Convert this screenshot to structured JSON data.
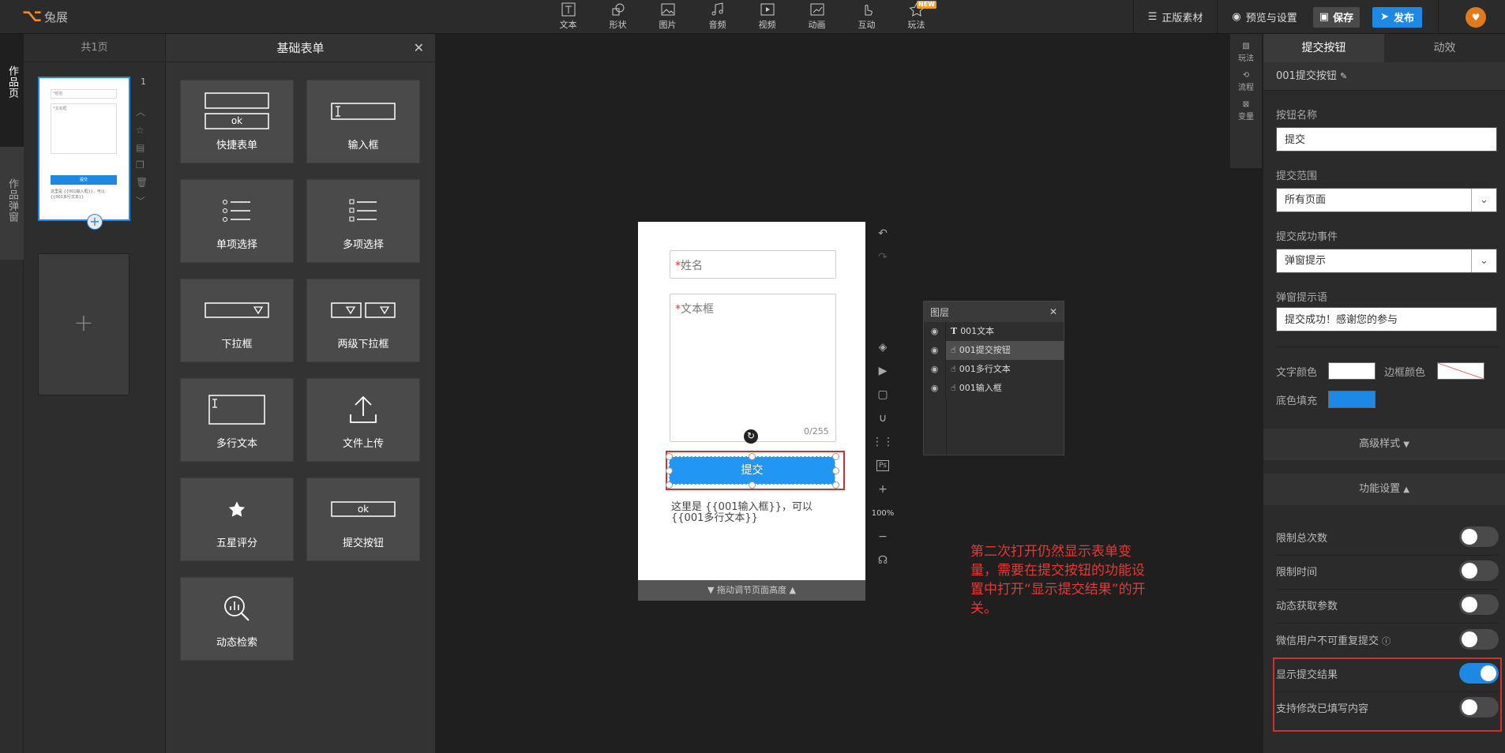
{
  "brand": {
    "name": "兔展"
  },
  "toolbar": {
    "tools": [
      {
        "label": "文本",
        "icon": "text-icon"
      },
      {
        "label": "形状",
        "icon": "shape-icon"
      },
      {
        "label": "图片",
        "icon": "image-icon"
      },
      {
        "label": "音频",
        "icon": "music-icon"
      },
      {
        "label": "视频",
        "icon": "video-icon"
      },
      {
        "label": "动画",
        "icon": "animation-icon"
      },
      {
        "label": "互动",
        "icon": "hand-icon"
      },
      {
        "label": "玩法",
        "icon": "star-icon",
        "badge": "NEW"
      }
    ],
    "material": "正版素材",
    "preview": "预览与设置",
    "save": "保存",
    "publish": "发布"
  },
  "left_tabs": {
    "works_page": "作品页",
    "works_popup": "作品弹窗"
  },
  "pages": {
    "header": "共1页",
    "page_number": "1",
    "thumb": {
      "field1": "*姓名",
      "field2": "*文本框",
      "button": "提交",
      "text": "这里是 {{001输入框}}，可以{{001多行文本}}"
    }
  },
  "components": {
    "title": "基础表单",
    "items": [
      {
        "label": "快捷表单"
      },
      {
        "label": "输入框"
      },
      {
        "label": "单项选择"
      },
      {
        "label": "多项选择"
      },
      {
        "label": "下拉框"
      },
      {
        "label": "两级下拉框"
      },
      {
        "label": "多行文本"
      },
      {
        "label": "文件上传"
      },
      {
        "label": "五星评分"
      },
      {
        "label": "提交按钮"
      },
      {
        "label": "动态检索"
      }
    ],
    "quick_form_ok": "ok",
    "submit_ok": "ok"
  },
  "canvas": {
    "name_placeholder": "姓名",
    "textarea_placeholder": "文本框",
    "required_mark": "*",
    "char_count": "0/255",
    "submit_label": "提交",
    "body_text": "这里是 {{001输入框}}，可以{{001多行文本}}",
    "bottom_bar": "拖动调节页面高度",
    "zoom": "100%"
  },
  "layers": {
    "title": "图层",
    "items": [
      {
        "label": "001文本",
        "selected": false
      },
      {
        "label": "001提交按钮",
        "selected": true
      },
      {
        "label": "001多行文本",
        "selected": false
      },
      {
        "label": "001输入框",
        "selected": false
      }
    ]
  },
  "annotation": "第二次打开仍然显示表单变量，需要在提交按钮的功能设置中打开“显示提交结果”的开关。",
  "quickbar": [
    {
      "label": "玩法"
    },
    {
      "label": "流程"
    },
    {
      "label": "变量"
    }
  ],
  "properties": {
    "tabs": [
      "提交按钮",
      "动效"
    ],
    "element_name": "001提交按钮",
    "button_name_label": "按钮名称",
    "button_name_value": "提交",
    "scope_label": "提交范围",
    "scope_value": "所有页面",
    "success_event_label": "提交成功事件",
    "success_event_value": "弹窗提示",
    "popup_msg_label": "弹窗提示语",
    "popup_msg_value": "提交成功！感谢您的参与",
    "text_color_label": "文字颜色",
    "border_color_label": "边框颜色",
    "fill_color_label": "底色填充",
    "text_color": "#ffffff",
    "fill_color": "#1e88e5",
    "advanced_style": "高级样式",
    "function_settings": "功能设置",
    "toggles": [
      {
        "label": "限制总次数",
        "on": false
      },
      {
        "label": "限制时间",
        "on": false
      },
      {
        "label": "动态获取参数",
        "on": false
      },
      {
        "label": "微信用户不可重复提交",
        "on": false
      },
      {
        "label": "显示提交结果",
        "on": true
      },
      {
        "label": "支持修改已填写内容",
        "on": false
      }
    ]
  }
}
